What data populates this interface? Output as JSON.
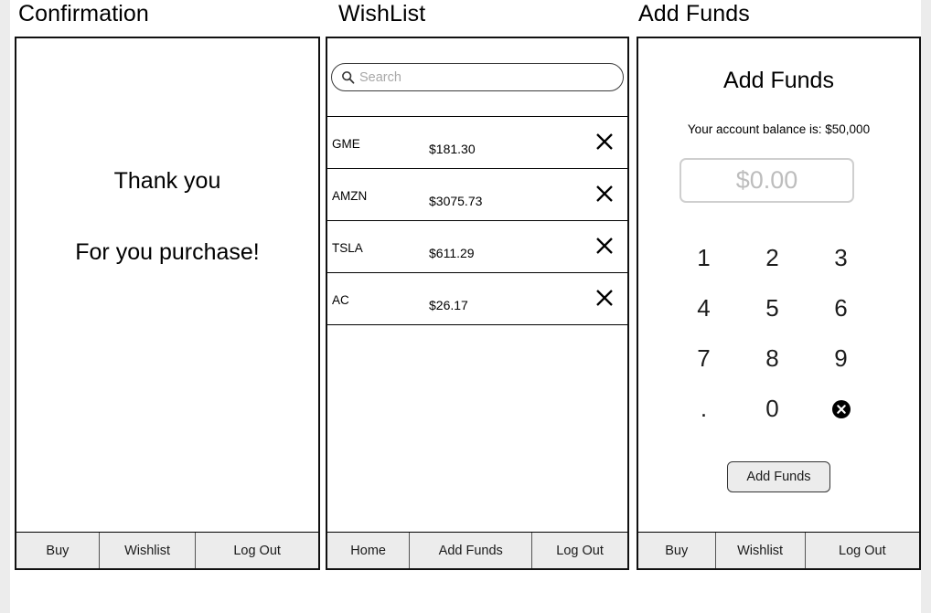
{
  "screens": [
    {
      "title": "Confirmation",
      "confirmation": {
        "line1": "Thank you",
        "line2": "For you purchase!"
      },
      "tabs": [
        {
          "label": "Buy"
        },
        {
          "label": "Wishlist"
        },
        {
          "label": "Log Out"
        }
      ]
    },
    {
      "title": "WishList",
      "search": {
        "placeholder": "Search",
        "value": "",
        "icon": "search-icon"
      },
      "rows": [
        {
          "ticker": "GME",
          "price": "$181.30",
          "remove_icon": "close-icon"
        },
        {
          "ticker": "AMZN",
          "price": "$3075.73",
          "remove_icon": "close-icon"
        },
        {
          "ticker": "TSLA",
          "price": "$611.29",
          "remove_icon": "close-icon"
        },
        {
          "ticker": "AC",
          "price": "$26.17",
          "remove_icon": "close-icon"
        }
      ],
      "tabs": [
        {
          "label": "Home"
        },
        {
          "label": "Add Funds"
        },
        {
          "label": "Log Out"
        }
      ]
    },
    {
      "title": "Add Funds",
      "addfunds": {
        "heading": "Add Funds",
        "balance_label": "Your account balance is:  $50,000",
        "amount_value": "",
        "amount_placeholder": "$0.00",
        "keys": [
          "1",
          "2",
          "3",
          "4",
          "5",
          "6",
          "7",
          "8",
          "9",
          ".",
          "0",
          ""
        ],
        "delete_key_icon": "backspace-circle-icon",
        "submit_label": "Add Funds"
      },
      "tabs": [
        {
          "label": "Buy"
        },
        {
          "label": "Wishlist"
        },
        {
          "label": "Log Out"
        }
      ]
    }
  ],
  "colors": {
    "border": "#111111",
    "tab_background": "#ececec",
    "placeholder": "#bdbdbd",
    "search_placeholder": "#a8a8a8",
    "page_background": "#ffffff",
    "edge_strip": "#ececec"
  }
}
